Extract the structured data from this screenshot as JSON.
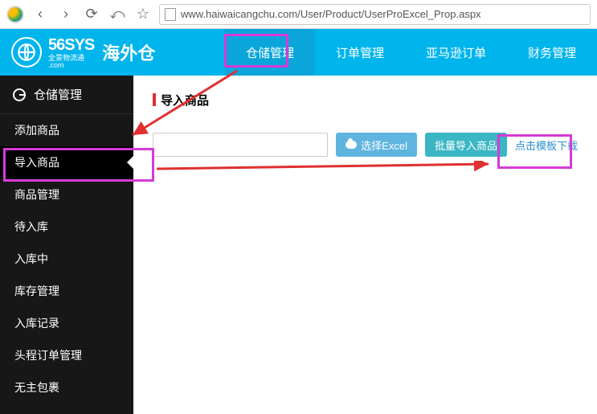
{
  "browser": {
    "url": "www.haiwaicangchu.com/User/Product/UserProExcel_Prop.aspx"
  },
  "brand": {
    "name": "56SYS",
    "sub1": "全景物流通",
    "sub2": ".com",
    "cn": "海外仓"
  },
  "topnav": [
    {
      "label": "仓储管理",
      "active": true
    },
    {
      "label": "订单管理",
      "active": false
    },
    {
      "label": "亚马逊订单",
      "active": false
    },
    {
      "label": "财务管理",
      "active": false
    }
  ],
  "sidebar": {
    "header": "仓储管理",
    "items": [
      {
        "label": "添加商品",
        "active": false
      },
      {
        "label": "导入商品",
        "active": true
      },
      {
        "label": "商品管理",
        "active": false
      },
      {
        "label": "待入库",
        "active": false
      },
      {
        "label": "入库中",
        "active": false
      },
      {
        "label": "库存管理",
        "active": false
      },
      {
        "label": "入库记录",
        "active": false
      },
      {
        "label": "头程订单管理",
        "active": false
      },
      {
        "label": "无主包裹",
        "active": false
      }
    ]
  },
  "main": {
    "title": "导入商品",
    "choose_excel": "选择Excel",
    "bulk_import": "批量导入商品",
    "download_template": "点击模板下载"
  }
}
